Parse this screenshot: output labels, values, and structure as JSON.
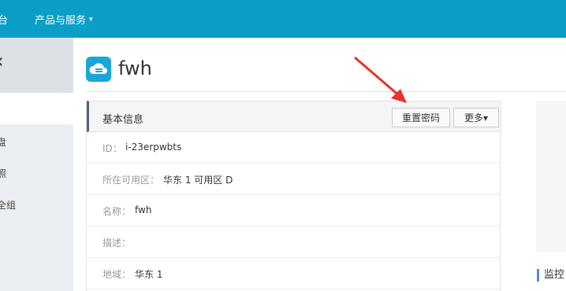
{
  "topbar": {
    "cut_text": "台",
    "menu_label": "产品与服务",
    "menu_caret": "▾"
  },
  "sidebar": {
    "back_glyph": "‹",
    "items": [
      "盘",
      "照",
      "全组"
    ]
  },
  "page": {
    "title": "fwh",
    "icon": "cloud-server-icon"
  },
  "panel": {
    "title": "基本信息",
    "reset_password_label": "重置密码",
    "more_label": "更多▾",
    "rows": [
      {
        "label": "ID：",
        "value": "i-23erpwbts"
      },
      {
        "label": "所在可用区：",
        "value": "华东 1 可用区 D"
      },
      {
        "label": "名称：",
        "value": "fwh"
      },
      {
        "label": "描述：",
        "value": ""
      },
      {
        "label": "地域：",
        "value": "华东 1"
      }
    ]
  },
  "monitor_label": "监控",
  "colors": {
    "topbar": "#0b9ec7",
    "arrow": "#e8322a",
    "panel_accent": "#546478",
    "icon": "#1ba6d9"
  }
}
